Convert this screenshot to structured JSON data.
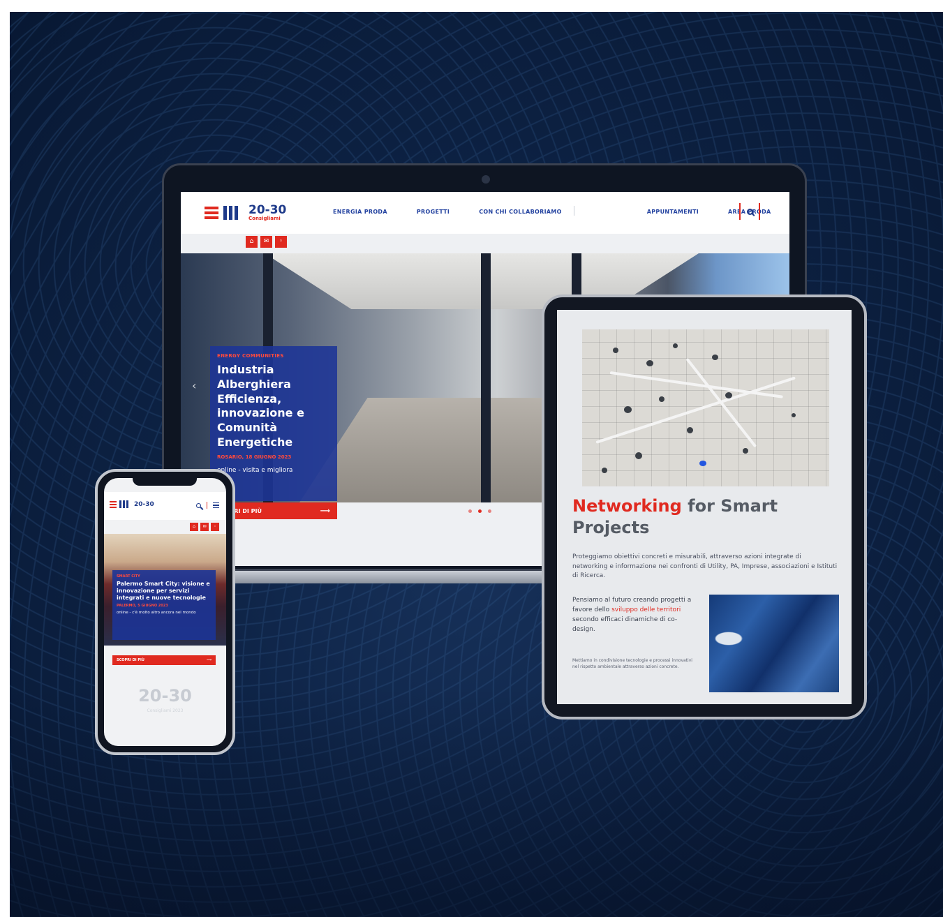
{
  "site": {
    "logo_text": "20-30",
    "logo_sub": "Consigliami",
    "nav": [
      "ENERGIA PRODA",
      "PROGETTI",
      "CON CHI COLLABORIAMO",
      "APPUNTAMENTI",
      "AREA PRODA"
    ],
    "social_icons": [
      "home-icon",
      "mail-icon",
      "share-icon"
    ]
  },
  "laptop": {
    "hero": {
      "eyebrow": "ENERGY COMMUNITIES",
      "title": "Industria Alberghiera Efficienza, innovazione e Comunità Energetiche",
      "date": "ROSARIO, 18 GIUGNO 2023",
      "description": "online - visita e migliora",
      "cta": "SCOPRI DI PIÙ",
      "cta_arrow": "⟶",
      "prev_arrow": "‹"
    },
    "carousel": {
      "slides": 3,
      "active": 1
    }
  },
  "tablet": {
    "heading_accent": "Networking",
    "heading_rest": "for Smart Projects",
    "paragraph": "Proteggiamo obiettivi concreti e misurabili, attraverso azioni integrate di networking e informazione nei confronti di Utility, PA, Imprese, associazioni e Istituti di Ricerca.",
    "col_before": "Pensiamo al futuro creando progetti a favore dello",
    "col_highlight": "sviluppo delle territori",
    "col_after": "secondo efficaci dinamiche di co-design.",
    "small_text": "Mettiamo in condivisione tecnologie e processi innovativi nel rispetto ambientale attraverso azioni concrete."
  },
  "phone": {
    "logo_text": "20-30",
    "eyebrow": "SMART CITY",
    "title": "Palermo Smart City: visione e innovazione per servizi integrati e nuove tecnologie",
    "date": "PALERMO, 5 GIUGNO 2023",
    "description": "online - c'è molto altro ancora nel mondo",
    "cta": "SCOPRI DI PIÙ",
    "cta_arrow": "⟶",
    "footer_logo": "20-30",
    "footer_sub": "Consigliami 2023"
  }
}
